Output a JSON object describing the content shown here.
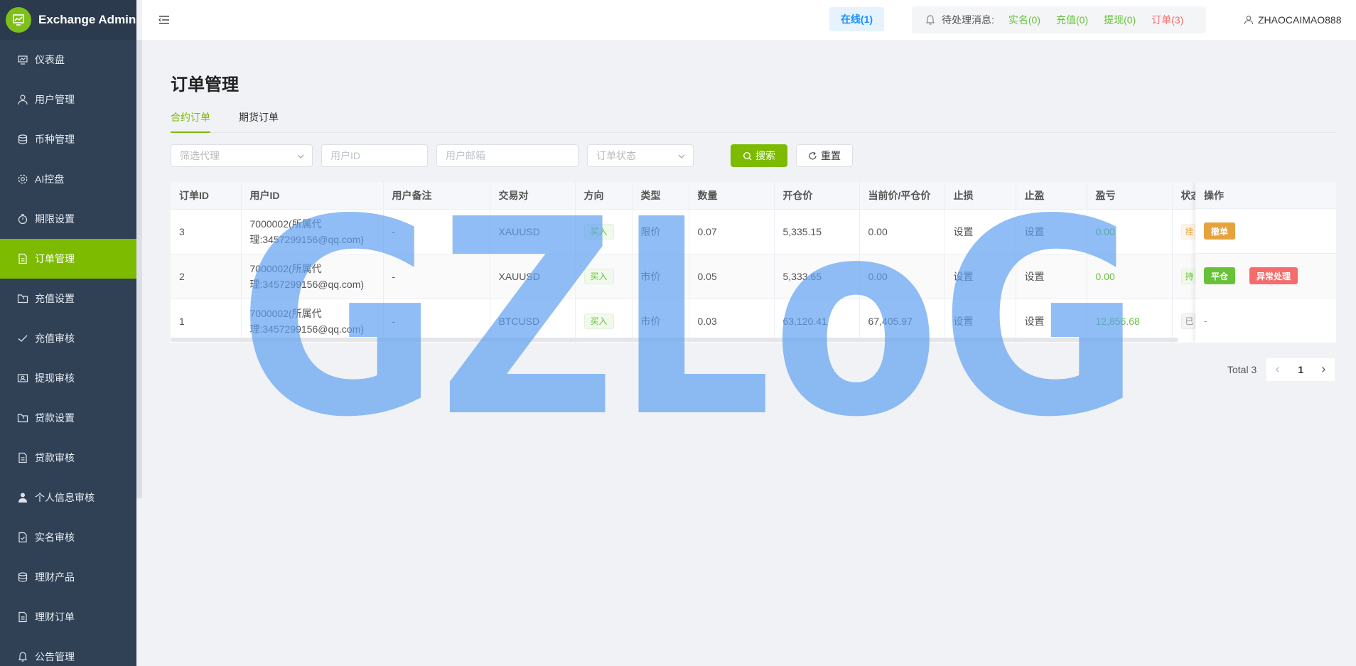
{
  "app": {
    "title": "Exchange Admin"
  },
  "sidebar": {
    "items": [
      {
        "label": "仪表盘",
        "icon": "dashboard-icon"
      },
      {
        "label": "用户管理",
        "icon": "user-icon"
      },
      {
        "label": "币种管理",
        "icon": "database-icon"
      },
      {
        "label": "AI控盘",
        "icon": "gear-icon"
      },
      {
        "label": "期限设置",
        "icon": "timer-icon"
      },
      {
        "label": "订单管理",
        "icon": "document-icon",
        "active": true
      },
      {
        "label": "充值设置",
        "icon": "folder-icon"
      },
      {
        "label": "充值审核",
        "icon": "check-icon"
      },
      {
        "label": "提现审核",
        "icon": "id-card-icon"
      },
      {
        "label": "贷款设置",
        "icon": "folder-icon"
      },
      {
        "label": "贷款审核",
        "icon": "document-icon"
      },
      {
        "label": "个人信息审核",
        "icon": "person-icon"
      },
      {
        "label": "实名审核",
        "icon": "document-check-icon"
      },
      {
        "label": "理财产品",
        "icon": "database-icon"
      },
      {
        "label": "理财订单",
        "icon": "document-icon"
      },
      {
        "label": "公告管理",
        "icon": "bell-icon"
      }
    ]
  },
  "header": {
    "online": "在线(1)",
    "pending_label": "待处理消息:",
    "realname": "实名(0)",
    "recharge": "充值(0)",
    "withdraw": "提现(0)",
    "orders": "订单(3)",
    "username": "ZHAOCAIMAO888"
  },
  "page": {
    "title": "订单管理",
    "tabs": [
      {
        "label": "合约订单",
        "active": true
      },
      {
        "label": "期货订单",
        "active": false
      }
    ]
  },
  "filters": {
    "agent_placeholder": "筛选代理",
    "userid_placeholder": "用户ID",
    "email_placeholder": "用户邮箱",
    "status_placeholder": "订单状态",
    "search_label": "搜索",
    "reset_label": "重置"
  },
  "table": {
    "columns": [
      "订单ID",
      "用户ID",
      "用户备注",
      "交易对",
      "方向",
      "类型",
      "数量",
      "开仓价",
      "当前价/平仓价",
      "止损",
      "止盈",
      "盈亏",
      "状态"
    ],
    "action_header": "操作",
    "rows": [
      {
        "id": "3",
        "user_line1": "7000002(所属代",
        "user_line2": "理:3457299156@qq.com)",
        "remark": "-",
        "pair": "XAUUSD",
        "direction": "买入",
        "type": "限价",
        "qty": "0.07",
        "open": "5,335.15",
        "current": "0.00",
        "sl": "设置",
        "tp": "设置",
        "pnl": "0.00",
        "status": "挂",
        "actions": [
          "撤单"
        ]
      },
      {
        "id": "2",
        "user_line1": "7000002(所属代",
        "user_line2": "理:3457299156@qq.com)",
        "remark": "-",
        "pair": "XAUUSD",
        "direction": "买入",
        "type": "市价",
        "qty": "0.05",
        "open": "5,333.65",
        "current": "0.00",
        "sl": "设置",
        "tp": "设置",
        "pnl": "0.00",
        "status": "持",
        "actions": [
          "平仓",
          "异常处理"
        ]
      },
      {
        "id": "1",
        "user_line1": "7000002(所属代",
        "user_line2": "理:3457299156@qq.com)",
        "remark": "-",
        "pair": "BTCUSD",
        "direction": "买入",
        "type": "市价",
        "qty": "0.03",
        "open": "63,120.41",
        "current": "67,405.97",
        "sl": "设置",
        "tp": "设置",
        "pnl": "12,856.68",
        "status": "已",
        "actions": [],
        "action_text": "-"
      }
    ]
  },
  "pagination": {
    "total": "Total 3",
    "current": "1"
  },
  "watermark": "GZLoG",
  "colors": {
    "accent": "#7cbb00",
    "sidebar": "#304156",
    "green": "#67c23a",
    "red": "#f56c6c",
    "orange": "#e6a23c",
    "watermark": "#5b9df0"
  }
}
